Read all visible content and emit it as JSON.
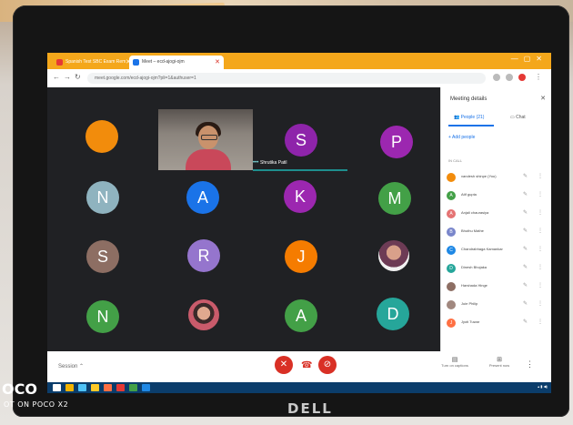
{
  "browser": {
    "tabs": [
      {
        "label": "Spanish Test SBC Exam Rem",
        "active": false
      },
      {
        "label": "Meet – ecd-ajogi-ojm",
        "active": true
      }
    ],
    "url": "meet.google.com/ecd-ajogi-ojm?pli=1&authuser=1"
  },
  "meeting": {
    "tiles": [
      {
        "letter": "",
        "color": "#f28c0c"
      },
      {
        "letter": "S",
        "color": "#8e24aa"
      },
      {
        "letter": "P",
        "color": "#9c27b0"
      },
      {
        "letter": "N",
        "color": "#8fb3bf"
      },
      {
        "letter": "A",
        "color": "#1a73e8"
      },
      {
        "letter": "K",
        "color": "#9c27b0"
      },
      {
        "letter": "M",
        "color": "#43a047"
      },
      {
        "letter": "S",
        "color": "#8d6e63"
      },
      {
        "letter": "R",
        "color": "#9575cd"
      },
      {
        "letter": "J",
        "color": "#f57c00"
      },
      {
        "letter": "N",
        "color": "#43a047"
      },
      {
        "letter": "A",
        "color": "#43a047"
      },
      {
        "letter": "D",
        "color": "#26a69a"
      }
    ],
    "presenter_name": "Shrutika Patil",
    "session_label": "Session",
    "captions_label": "Turn on captions",
    "present_label": "Present now"
  },
  "panel": {
    "title": "Meeting details",
    "people_tab": "People (21)",
    "chat_tab": "Chat",
    "add_people": "Add people",
    "in_call": "IN CALL",
    "people": [
      {
        "name": "vandesh shinpe (You)",
        "color": "#f28c0c"
      },
      {
        "name": "Atif gupta",
        "color": "#43a047"
      },
      {
        "name": "Anjali chaurasiya",
        "color": "#e57373"
      },
      {
        "name": "Bhuthu Mathe",
        "color": "#7986cb"
      },
      {
        "name": "Chandrabhaga Kamankar",
        "color": "#1e88e5"
      },
      {
        "name": "Dinesh Bhojaka",
        "color": "#26a69a"
      },
      {
        "name": "Harshada Hinge",
        "color": "#8d6e63"
      },
      {
        "name": "Juie Philip",
        "color": "#a1887f"
      },
      {
        "name": "Jyoti Tuwar",
        "color": "#ff7043"
      }
    ]
  },
  "watermark": {
    "brand": "OCO",
    "shot_on": "OT ON POCO X2"
  },
  "monitor_brand": "DELL"
}
